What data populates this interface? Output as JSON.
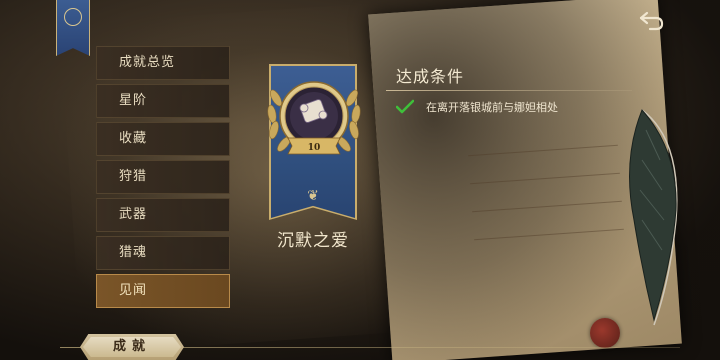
{
  "menu": {
    "items": [
      {
        "label": "成就总览"
      },
      {
        "label": "星阶"
      },
      {
        "label": "收藏"
      },
      {
        "label": "狩猎"
      },
      {
        "label": "武器"
      },
      {
        "label": "猎魂"
      },
      {
        "label": "见闻"
      }
    ],
    "active_index": 6
  },
  "achievement": {
    "title": "沉默之爱",
    "level": "10"
  },
  "conditions": {
    "heading": "达成条件",
    "items": [
      {
        "text": "在离开落银城前与娜妲相处",
        "completed": true
      }
    ]
  },
  "bottom_tab": {
    "label": "成就"
  },
  "colors": {
    "banner_blue": "#30507f",
    "gold": "#c9ad6c",
    "active_menu": "#7a5528",
    "check_green": "#3fbf3a"
  },
  "icons": {
    "back": "back-arrow-icon",
    "check": "check-icon",
    "corner_emblem": "laurel-emblem-icon",
    "medal": "laurel-medal-icon",
    "feather": "quill-feather-icon",
    "seal": "wax-seal-icon"
  }
}
